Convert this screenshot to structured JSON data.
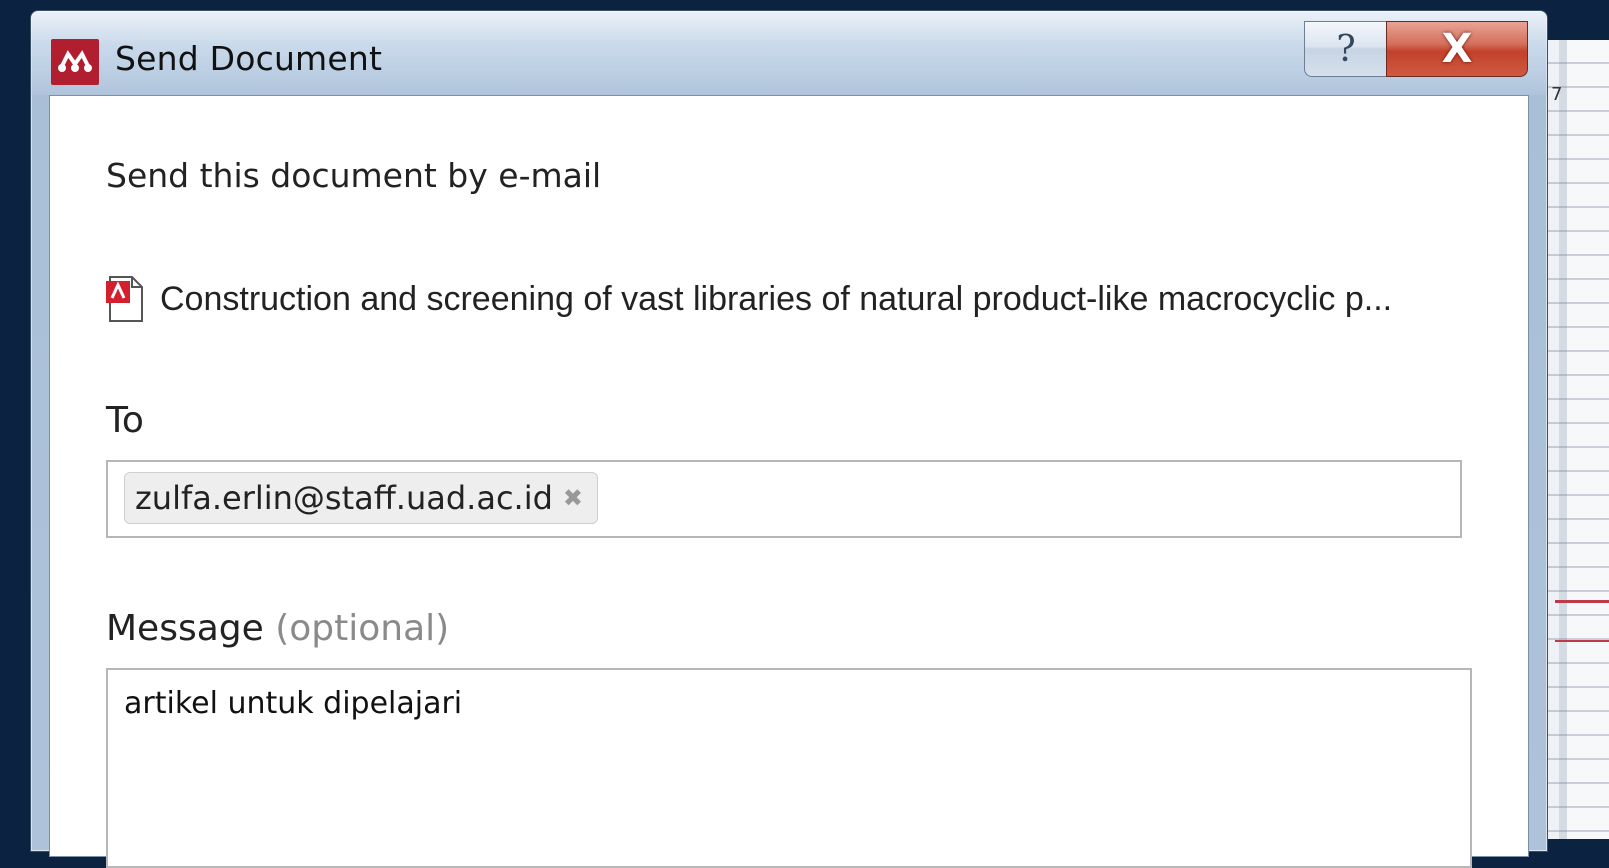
{
  "window": {
    "title": "Send Document",
    "help_symbol": "?",
    "close_symbol": "X"
  },
  "dialog": {
    "heading": "Send this document by e-mail",
    "document": {
      "icon": "pdf-file-icon",
      "title": "Construction and screening of vast libraries of natural product-like macrocyclic p..."
    },
    "to": {
      "label": "To",
      "recipients": [
        "zulfa.erlin@staff.uad.ac.id"
      ],
      "remove_symbol": "✖"
    },
    "message": {
      "label": "Message",
      "optional_hint": "(optional)",
      "value": "artikel untuk dipelajari"
    }
  },
  "background": {
    "edge_digit": "7"
  },
  "colors": {
    "logo_red": "#b01e2f",
    "close_red": "#c4402b",
    "desktop": "#0b2341"
  }
}
